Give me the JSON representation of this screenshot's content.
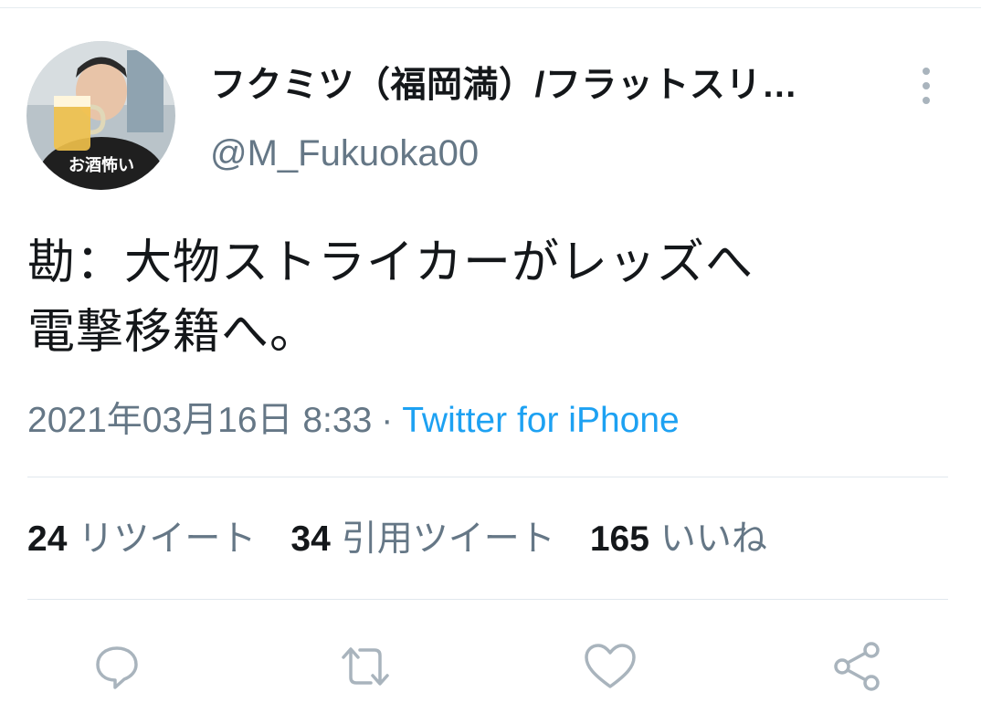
{
  "user": {
    "display_name": "フクミツ（福岡満）/フラットスリ…",
    "handle": "@M_Fukuoka00",
    "avatar_text": "お酒怖い"
  },
  "tweet": {
    "lines": [
      "勘：大物ストライカーがレッズへ",
      "電撃移籍へ。"
    ],
    "timestamp": "2021年03月16日 8:33",
    "separator": "·",
    "source": "Twitter for iPhone"
  },
  "stats": {
    "retweets": {
      "count": "24",
      "label": "リツイート"
    },
    "quotes": {
      "count": "34",
      "label": "引用ツイート"
    },
    "likes": {
      "count": "165",
      "label": "いいね"
    }
  },
  "actions": {
    "reply": "reply-icon",
    "retweet": "retweet-icon",
    "like": "heart-icon",
    "share": "share-icon"
  },
  "colors": {
    "text": "#14171a",
    "secondary": "#657786",
    "link": "#1da1f2",
    "divider": "#e1e8ed"
  }
}
